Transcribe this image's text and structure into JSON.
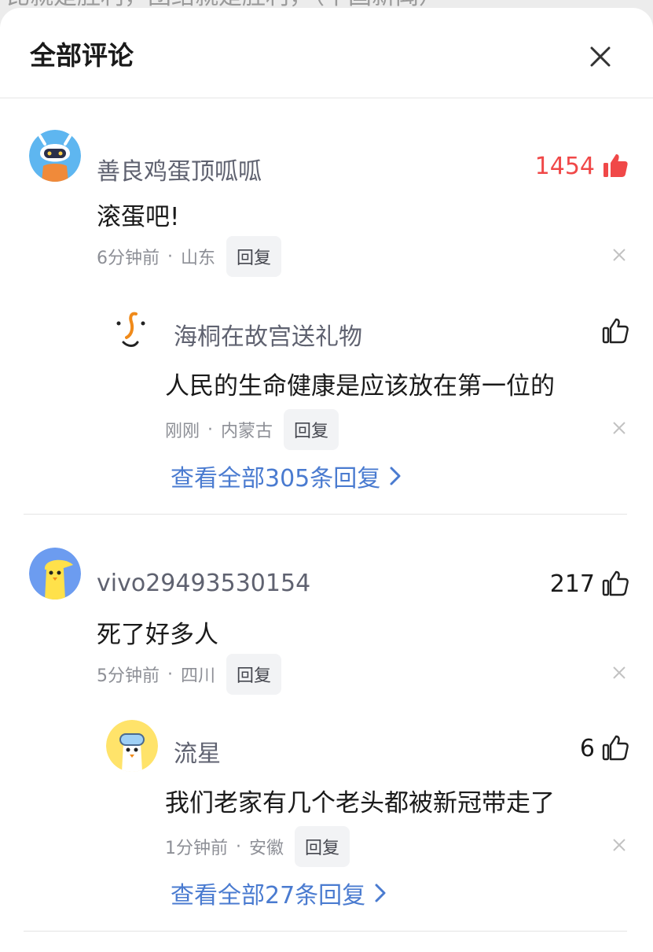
{
  "background_text": "比就是胜利，团结就是胜利，（中国新闻）",
  "header": {
    "title": "全部评论",
    "close_icon": "close-icon"
  },
  "comments": [
    {
      "username": "善良鸡蛋顶呱呱",
      "likes": "1454",
      "liked": true,
      "text": "滚蛋吧!",
      "time": "6分钟前",
      "location": "山东",
      "reply_label": "回复",
      "reply": {
        "username": "海桐在故宫送礼物",
        "likes": "",
        "text": "人民的生命健康是应该放在第一位的",
        "time": "刚刚",
        "location": "内蒙古",
        "reply_label": "回复"
      },
      "view_all": "查看全部305条回复"
    },
    {
      "username": "vivo29493530154",
      "likes": "217",
      "liked": false,
      "text": "死了好多人",
      "time": "5分钟前",
      "location": "四川",
      "reply_label": "回复",
      "reply": {
        "username": "流星",
        "likes": "6",
        "text": "我们老家有几个老头都被新冠带走了",
        "time": "1分钟前",
        "location": "安徽",
        "reply_label": "回复"
      },
      "view_all": "查看全部27条回复"
    }
  ],
  "colors": {
    "hot_like": "#f04848",
    "link": "#4a7bd0",
    "username": "#5f6270",
    "meta": "#8d8f96"
  },
  "separator": "·"
}
